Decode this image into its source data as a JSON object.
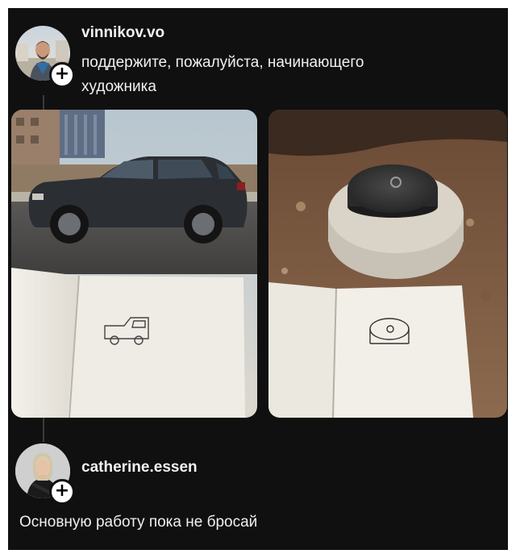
{
  "post1": {
    "username": "vinnikov.vo",
    "text": "поддержите, пожалуйста, начинающего художника",
    "images": [
      {
        "alt": "photo of a dark car with a notebook sketch of a car",
        "icon": "car-drawing"
      },
      {
        "alt": "photo of a manhole with a notebook sketch of a manhole",
        "icon": "manhole-drawing"
      }
    ]
  },
  "reply": {
    "username": "catherine.essen",
    "text": "Основную работу пока не бросай"
  },
  "icons": {
    "follow": "plus-icon"
  },
  "colors": {
    "background": "#101010",
    "text": "#f2f2f2",
    "thread_line": "#3a3a3a"
  }
}
